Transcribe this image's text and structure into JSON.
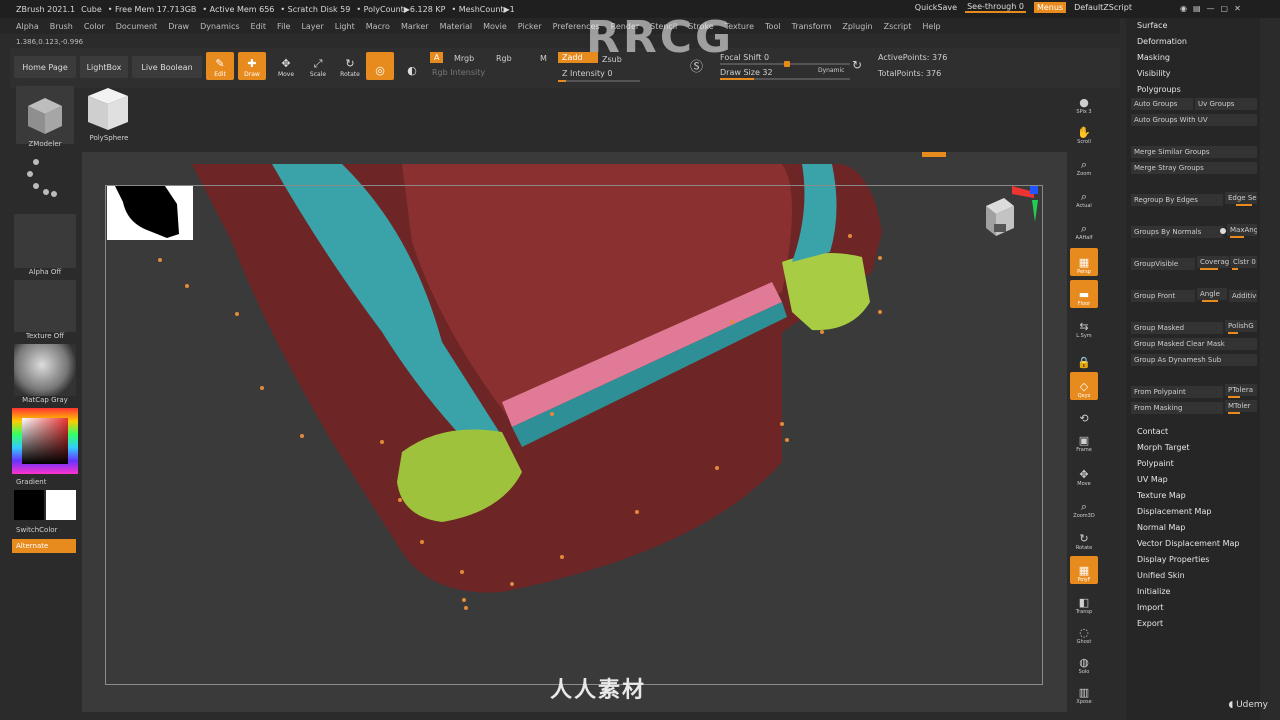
{
  "titlebar": {
    "app": "ZBrush 2021.1",
    "doc": "Cube",
    "free_mem": "• Free Mem 17.713GB",
    "active_mem": "• Active Mem 656",
    "scratch": "• Scratch Disk 59",
    "polycount": "• PolyCount▶6.128 KP",
    "meshcount": "• MeshCount▶1",
    "quicksave": "QuickSave",
    "see_through": "See-through  0",
    "menus": "Menus",
    "default_script": "DefaultZScript"
  },
  "menubar": [
    "Alpha",
    "Brush",
    "Color",
    "Document",
    "Draw",
    "Dynamics",
    "Edit",
    "File",
    "Layer",
    "Light",
    "Macro",
    "Marker",
    "Material",
    "Movie",
    "Picker",
    "Preferences",
    "Render",
    "Stencil",
    "Stroke",
    "Texture",
    "Tool",
    "Transform",
    "Zplugin",
    "Zscript",
    "Help"
  ],
  "coords": "1.386,0.123,-0.996",
  "topbar": {
    "home": "Home Page",
    "lightbox": "LightBox",
    "live_boolean": "Live Boolean",
    "edit": "Edit",
    "draw": "Draw",
    "move": "Move",
    "scale": "Scale",
    "rotate": "Rotate",
    "a": "A",
    "mrgb": "Mrgb",
    "rgb": "Rgb",
    "m": "M",
    "zadd": "Zadd",
    "zsub": "Zsub",
    "rgb_intensity": "Rgb Intensity",
    "z_intensity": "Z Intensity 0",
    "focal_shift": "Focal Shift 0",
    "draw_size": "Draw Size 32",
    "dynamic": "Dynamic",
    "active_points": "ActivePoints: 376",
    "total_points": "TotalPoints: 376"
  },
  "leftpanel": {
    "zmodeler": "ZModeler",
    "polysphere": "PolySphere",
    "alpha_off": "Alpha Off",
    "texture_off": "Texture Off",
    "matcap": "MatCap Gray",
    "gradient": "Gradient",
    "switchcolor": "SwitchColor",
    "alternate": "Alternate"
  },
  "shelf": [
    "SPix 3",
    "Scroll",
    "Zoom",
    "Actual",
    "AAHalf",
    "Persp",
    "Floor",
    "L.Sym",
    "",
    "Qxyz",
    "",
    "Frame",
    "Move",
    "Zoom3D",
    "Rotate",
    "PolyF",
    "Transp",
    "Ghost",
    "Solo",
    "Xpose"
  ],
  "rpanel": {
    "surface": "Surface",
    "deformation": "Deformation",
    "masking": "Masking",
    "visibility": "Visibility",
    "polygroups": "Polygroups",
    "auto_groups": "Auto Groups",
    "uv_groups": "Uv Groups",
    "auto_groups_uv": "Auto Groups With UV",
    "merge_similar": "Merge Similar Groups",
    "merge_stray": "Merge Stray Groups",
    "regroup_edges": "Regroup By Edges",
    "edge_se": "Edge Se",
    "groups_normals": "Groups By Normals",
    "maxang": "MaxAng",
    "group_visible": "GroupVisible",
    "coverage": "Coverag",
    "clstr": "Clstr 0",
    "group_front": "Group Front",
    "angle": "Angle",
    "additive": "Additive",
    "group_masked": "Group Masked",
    "polishg": "PolishG",
    "group_masked_clear": "Group Masked Clear Mask",
    "group_as_dynamesh": "Group As Dynamesh Sub",
    "from_polypaint": "From Polypaint",
    "ptolera": "PTolera",
    "from_masking": "From Masking",
    "mtolera": "MToler",
    "contact": "Contact",
    "morph_target": "Morph Target",
    "polypaint": "Polypaint",
    "uv_map": "UV Map",
    "texture_map": "Texture Map",
    "displacement_map": "Displacement Map",
    "normal_map": "Normal Map",
    "vector_displacement_map": "Vector Displacement Map",
    "display_properties": "Display Properties",
    "unified_skin": "Unified Skin",
    "initialize": "Initialize",
    "import": "Import",
    "export": "Export"
  },
  "brand": "Udemy",
  "logo": "人人素材",
  "watermark": "RRCG",
  "colors": {
    "accent": "#e88b1f",
    "teal": "#3aa9b0",
    "maroon": "#7a2a2a",
    "pink": "#d96b8a",
    "green": "#9fc23c"
  }
}
